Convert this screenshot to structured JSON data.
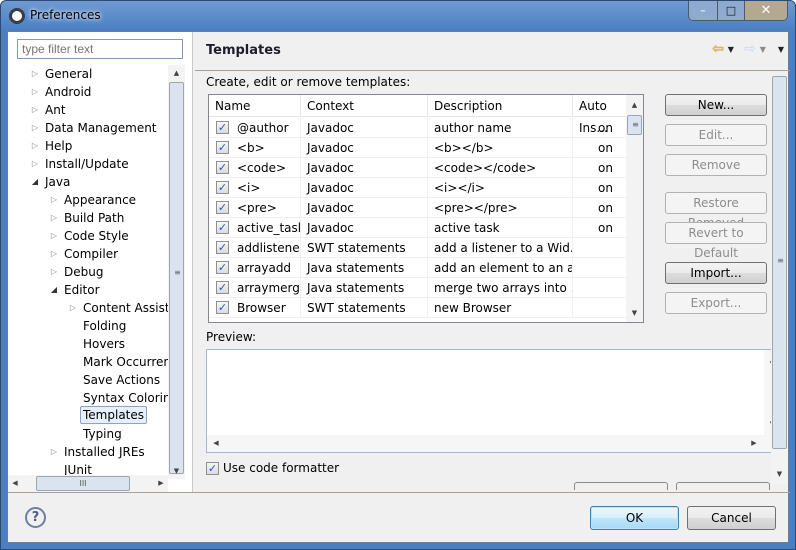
{
  "window": {
    "title": "Preferences",
    "controls": {
      "minimize": "–",
      "maximize": "□",
      "close": "✕"
    }
  },
  "sidebar": {
    "filter_placeholder": "type filter text",
    "tree": [
      {
        "label": "General",
        "level": 0,
        "expander": "collapsed"
      },
      {
        "label": "Android",
        "level": 0,
        "expander": "collapsed"
      },
      {
        "label": "Ant",
        "level": 0,
        "expander": "collapsed"
      },
      {
        "label": "Data Management",
        "level": 0,
        "expander": "collapsed"
      },
      {
        "label": "Help",
        "level": 0,
        "expander": "collapsed"
      },
      {
        "label": "Install/Update",
        "level": 0,
        "expander": "collapsed"
      },
      {
        "label": "Java",
        "level": 0,
        "expander": "expanded"
      },
      {
        "label": "Appearance",
        "level": 1,
        "expander": "collapsed"
      },
      {
        "label": "Build Path",
        "level": 1,
        "expander": "collapsed"
      },
      {
        "label": "Code Style",
        "level": 1,
        "expander": "collapsed"
      },
      {
        "label": "Compiler",
        "level": 1,
        "expander": "collapsed"
      },
      {
        "label": "Debug",
        "level": 1,
        "expander": "collapsed"
      },
      {
        "label": "Editor",
        "level": 1,
        "expander": "expanded"
      },
      {
        "label": "Content Assist",
        "level": 2,
        "expander": "collapsed"
      },
      {
        "label": "Folding",
        "level": 2,
        "expander": "none"
      },
      {
        "label": "Hovers",
        "level": 2,
        "expander": "none"
      },
      {
        "label": "Mark Occurrences",
        "level": 2,
        "expander": "none"
      },
      {
        "label": "Save Actions",
        "level": 2,
        "expander": "none"
      },
      {
        "label": "Syntax Coloring",
        "level": 2,
        "expander": "none"
      },
      {
        "label": "Templates",
        "level": 2,
        "expander": "none",
        "selected": true
      },
      {
        "label": "Typing",
        "level": 2,
        "expander": "none"
      },
      {
        "label": "Installed JREs",
        "level": 1,
        "expander": "collapsed"
      },
      {
        "label": "JUnit",
        "level": 1,
        "expander": "none"
      }
    ],
    "hscroll_grip": "III",
    "vscroll_grip": "≡"
  },
  "page": {
    "title": "Templates",
    "description_label": "Create, edit or remove templates:",
    "nav": {
      "back": "⇦",
      "forward": "⇨",
      "dropdown": "▼"
    },
    "table": {
      "columns": [
        "Name",
        "Context",
        "Description",
        "Auto Ins..."
      ],
      "rows": [
        {
          "checked": true,
          "name": "@author",
          "context": "Javadoc",
          "description": "author name",
          "auto_insert": "on"
        },
        {
          "checked": true,
          "name": "<b>",
          "context": "Javadoc",
          "description": "<b></b>",
          "auto_insert": "on"
        },
        {
          "checked": true,
          "name": "<code>",
          "context": "Javadoc",
          "description": "<code></code>",
          "auto_insert": "on"
        },
        {
          "checked": true,
          "name": "<i>",
          "context": "Javadoc",
          "description": "<i></i>",
          "auto_insert": "on"
        },
        {
          "checked": true,
          "name": "<pre>",
          "context": "Javadoc",
          "description": "<pre></pre>",
          "auto_insert": "on"
        },
        {
          "checked": true,
          "name": "active_task",
          "context": "Javadoc",
          "description": "active task",
          "auto_insert": "on"
        },
        {
          "checked": true,
          "name": "addlistener",
          "context": "SWT statements",
          "description": "add a listener to a Wid...",
          "auto_insert": ""
        },
        {
          "checked": true,
          "name": "arrayadd",
          "context": "Java statements",
          "description": "add an element to an a...",
          "auto_insert": ""
        },
        {
          "checked": true,
          "name": "arraymerge",
          "context": "Java statements",
          "description": "merge two arrays into ...",
          "auto_insert": ""
        },
        {
          "checked": true,
          "name": "Browser",
          "context": "SWT statements",
          "description": "new Browser",
          "auto_insert": ""
        }
      ]
    },
    "buttons": [
      {
        "label": "New...",
        "enabled": true
      },
      {
        "label": "Edit...",
        "enabled": false
      },
      {
        "label": "Remove",
        "enabled": false
      },
      {
        "label": "Restore Removed",
        "enabled": false
      },
      {
        "label": "Revert to Default",
        "enabled": false
      },
      {
        "label": "Import...",
        "enabled": true
      },
      {
        "label": "Export...",
        "enabled": false
      }
    ],
    "preview_label": "Preview:",
    "preview_content": "",
    "use_code_formatter": {
      "label": "Use code formatter",
      "checked": true
    }
  },
  "footer": {
    "help": "?",
    "ok": "OK",
    "cancel": "Cancel"
  },
  "symbols": {
    "check": "✓",
    "arrow_up": "▲",
    "arrow_down": "▼",
    "arrow_left": "◀",
    "arrow_right": "▶",
    "tree_collapsed": "▷",
    "tree_expanded": "◢"
  }
}
